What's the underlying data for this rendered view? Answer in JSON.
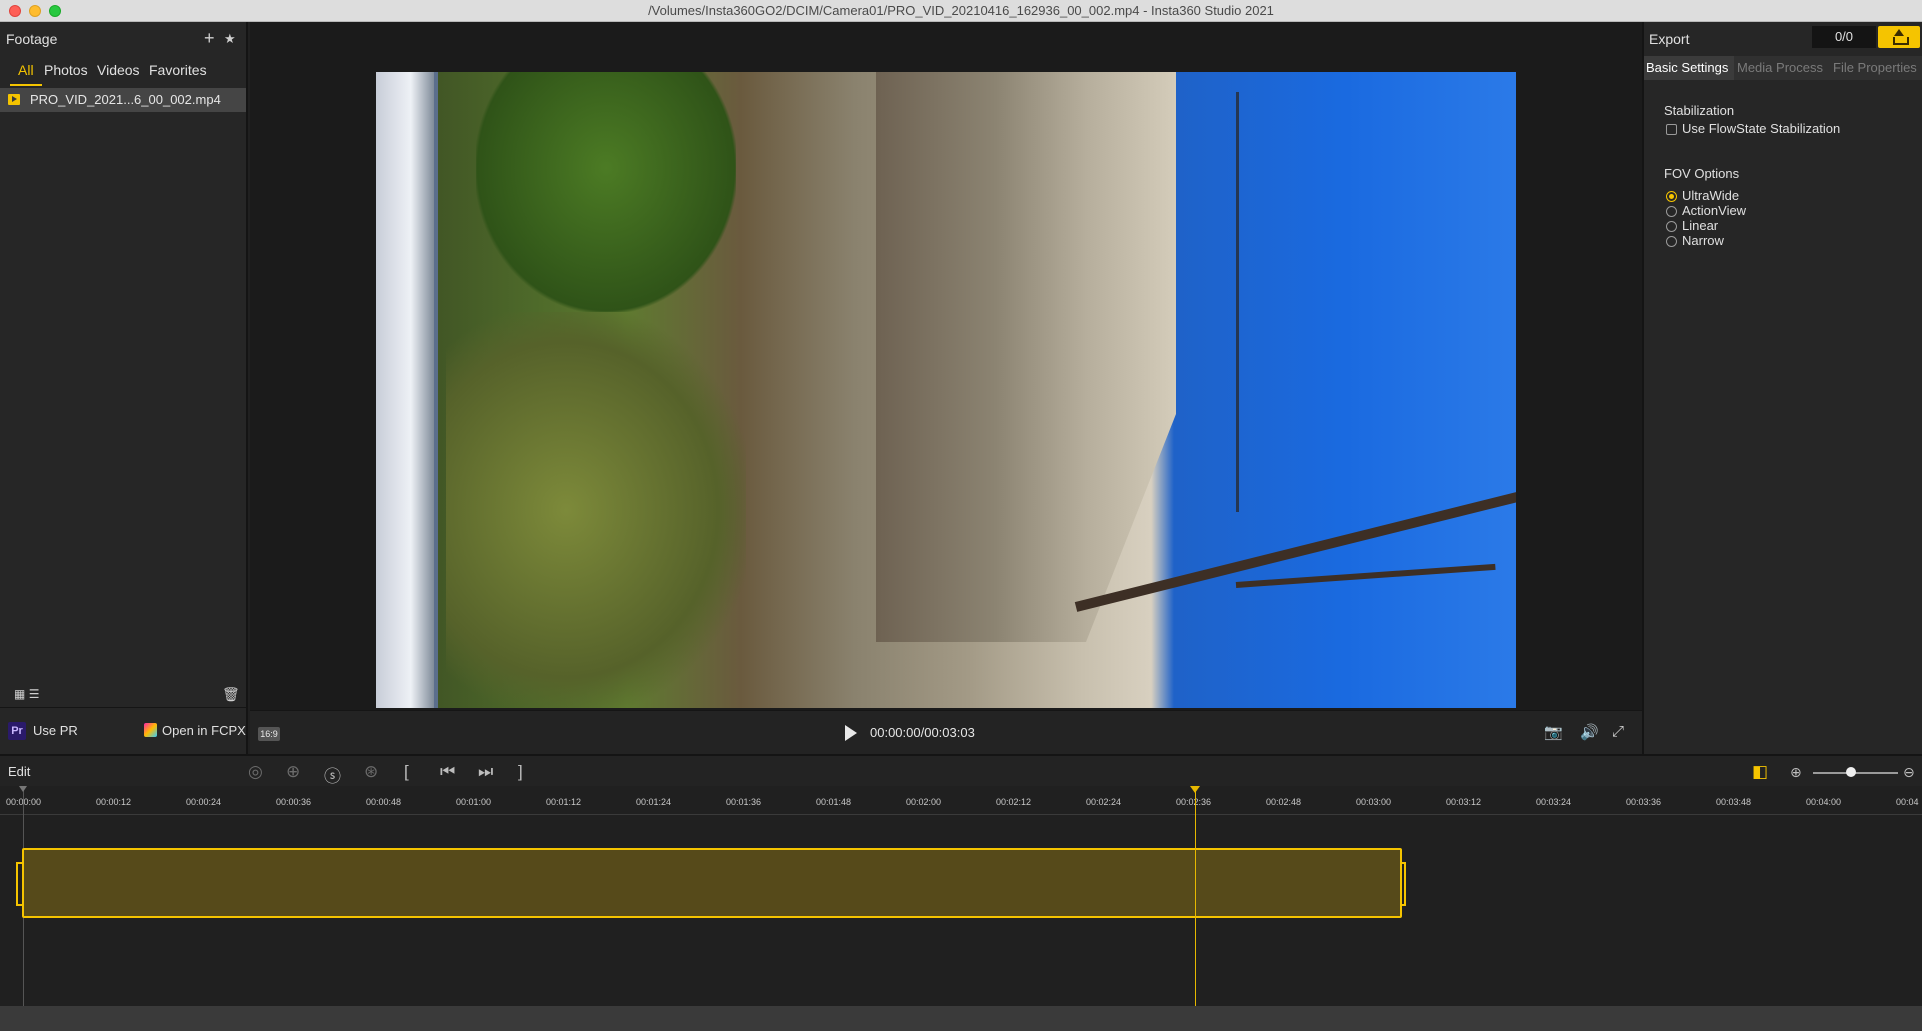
{
  "window": {
    "title": "/Volumes/Insta360GO2/DCIM/Camera01/PRO_VID_20210416_162936_00_002.mp4 - Insta360 Studio 2021"
  },
  "footage_panel": {
    "title": "Footage",
    "tabs": [
      "All",
      "Photos",
      "Videos",
      "Favorites"
    ],
    "active_tab": "All",
    "files": [
      {
        "name": "PRO_VID_2021...6_00_002.mp4",
        "type": "video",
        "selected": true
      }
    ],
    "actions": {
      "pr_badge": "Pr",
      "use_pr": "Use PR",
      "open_fcpx": "Open in FCPX"
    },
    "icons": [
      "add-icon",
      "add-favorite-folder-icon",
      "grid-view-icon",
      "list-view-icon",
      "trash-icon"
    ]
  },
  "preview": {
    "aspect_ratio": "16:9",
    "timecode": "00:00:00/00:03:03",
    "icons": [
      "play-icon",
      "camera-icon",
      "volume-icon",
      "fullscreen-icon"
    ]
  },
  "export_panel": {
    "title": "Export",
    "count": "0/0",
    "tabs": [
      "Basic Settings",
      "Media Process",
      "File Properties"
    ],
    "active_tab": "Basic Settings",
    "stabilization": {
      "title": "Stabilization",
      "option_label": "Use FlowState Stabilization",
      "checked": false
    },
    "fov": {
      "title": "FOV Options",
      "options": [
        "UltraWide",
        "ActionView",
        "Linear",
        "Narrow"
      ],
      "selected": "UltraWide"
    },
    "accent_color": "#f5c400"
  },
  "edit": {
    "label": "Edit",
    "tools": [
      "keyframe-icon",
      "viewfinder-icon",
      "speed-icon",
      "timeshift-icon",
      "trim-start-icon",
      "skip-back-icon",
      "skip-forward-icon",
      "trim-end-icon"
    ],
    "ruler_ticks": [
      "00:00:00",
      "00:00:12",
      "00:00:24",
      "00:00:36",
      "00:00:48",
      "00:01:00",
      "00:01:12",
      "00:01:24",
      "00:01:36",
      "00:01:48",
      "00:02:00",
      "00:02:12",
      "00:02:24",
      "00:02:36",
      "00:02:48",
      "00:03:00",
      "00:03:12",
      "00:03:24",
      "00:03:36",
      "00:03:48",
      "00:04:00",
      "00:04"
    ],
    "playhead_time": "00:02:36",
    "clip_duration": "00:03:03"
  }
}
